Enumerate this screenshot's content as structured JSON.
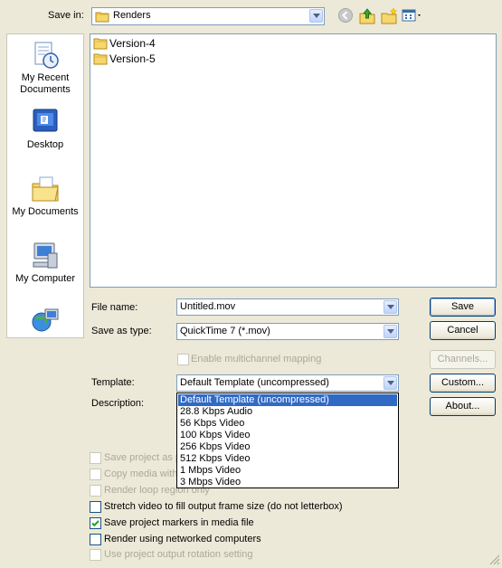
{
  "header": {
    "save_in_label": "Save in:",
    "save_in_value": "Renders"
  },
  "toolbar": {
    "icons": [
      "back-icon",
      "up-folder-icon",
      "new-folder-icon",
      "views-menu-icon"
    ]
  },
  "places": [
    {
      "label": "My Recent Documents",
      "icon": "recent-documents-icon"
    },
    {
      "label": "Desktop",
      "icon": "desktop-icon"
    },
    {
      "label": "My Documents",
      "icon": "my-documents-icon"
    },
    {
      "label": "My Computer",
      "icon": "my-computer-icon"
    },
    {
      "label": "",
      "icon": "network-places-icon"
    }
  ],
  "files": [
    "Version-4",
    "Version-5"
  ],
  "form": {
    "file_name_label": "File name:",
    "file_name_value": "Untitled.mov",
    "save_as_type_label": "Save as type:",
    "save_as_type_value": "QuickTime 7 (*.mov)",
    "multichannel_label": "Enable multichannel mapping",
    "template_label": "Template:",
    "template_value": "Default Template (uncompressed)",
    "description_label": "Description:"
  },
  "buttons": {
    "save": "Save",
    "cancel": "Cancel",
    "channels": "Channels...",
    "custom": "Custom...",
    "about": "About..."
  },
  "template_options": [
    "Default Template (uncompressed)",
    "28.8 Kbps Audio",
    "56 Kbps Video",
    "100 Kbps Video",
    "256 Kbps Video",
    "512 Kbps Video",
    "1 Mbps Video",
    "3 Mbps Video"
  ],
  "template_selected_index": 0,
  "options": [
    {
      "label": "Save project as p",
      "checked": false,
      "enabled": false
    },
    {
      "label": "Copy media with",
      "checked": false,
      "enabled": false
    },
    {
      "label": "Render loop region only",
      "checked": false,
      "enabled": false
    },
    {
      "label": "Stretch video to fill output frame size (do not letterbox)",
      "checked": false,
      "enabled": true
    },
    {
      "label": "Save project markers in media file",
      "checked": true,
      "enabled": true
    },
    {
      "label": "Render using networked computers",
      "checked": false,
      "enabled": true
    },
    {
      "label": "Use project output rotation setting",
      "checked": false,
      "enabled": false
    }
  ],
  "colors": {
    "dialog_bg": "#ece9d8",
    "selection": "#316ac5",
    "border": "#7f9db9"
  }
}
